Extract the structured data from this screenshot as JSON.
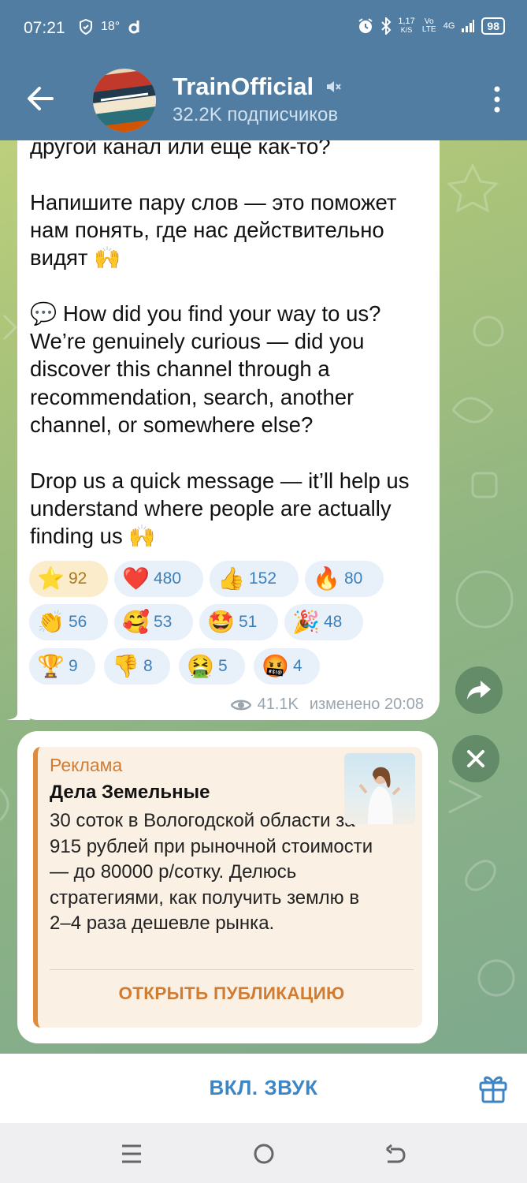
{
  "status_bar": {
    "time": "07:21",
    "temp": "18°",
    "speed": "1,17",
    "speed_unit": "K/S",
    "net1": "Vo LTE",
    "net2": "4G",
    "battery": "98"
  },
  "header": {
    "channel_name": "TrainOfficial",
    "subscribers": "32.2K подписчиков",
    "icons": [
      "back-arrow-icon",
      "muted-icon",
      "more-vert-icon"
    ]
  },
  "message": {
    "text": "другой канал или еще как-то?\n\nНапишите пару слов — это поможет нам понять, где нас действительно видят 🙌\n\n💬 How did you find your way to us? We’re genuinely curious — did you discover this channel through a recommendation, search, another channel, or somewhere else?\n\nDrop us a quick message — it’ll help us understand where people are actually finding us 🙌",
    "reactions": [
      {
        "emoji": "⭐",
        "count": "92",
        "chosen": true
      },
      {
        "emoji": "❤️",
        "count": "480"
      },
      {
        "emoji": "👍",
        "count": "152"
      },
      {
        "emoji": "🔥",
        "count": "80"
      },
      {
        "emoji": "👏",
        "count": "56"
      },
      {
        "emoji": "🥰",
        "count": "53"
      },
      {
        "emoji": "🤩",
        "count": "51"
      },
      {
        "emoji": "🎉",
        "count": "48"
      },
      {
        "emoji": "🏆",
        "count": "9"
      },
      {
        "emoji": "👎",
        "count": "8"
      },
      {
        "emoji": "🤮",
        "count": "5"
      },
      {
        "emoji": "🤬",
        "count": "4"
      }
    ],
    "views": "41.1K",
    "edited": "изменено 20:08"
  },
  "ad": {
    "label": "Реклама",
    "title": "Дела Земельные",
    "body": "30 соток в Вологодской области за 915 рублей при рыночной стоимости — до 80000 р/сотку. Делюсь стратегиями, как получить землю в 2–4 раза дешевле рынка.",
    "open_label": "ОТКРЫТЬ ПУБЛИКАЦИЮ"
  },
  "bottom": {
    "unmute_label": "ВКЛ. ЗВУК"
  },
  "colors": {
    "header": "#517da2",
    "accent": "#3d86c6",
    "ad_accent": "#d07c33"
  }
}
